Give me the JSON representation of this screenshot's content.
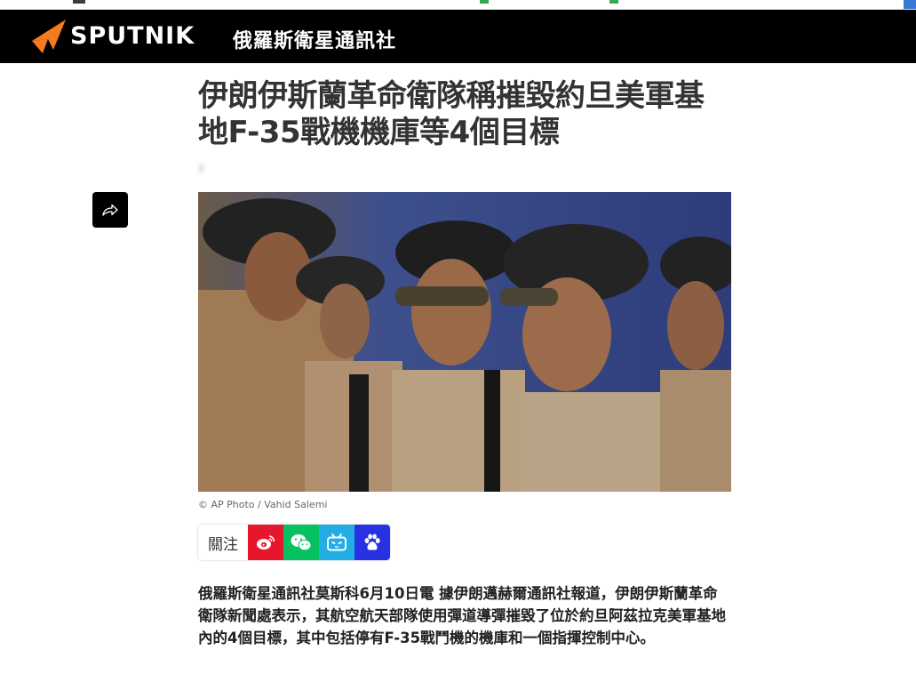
{
  "header": {
    "brand_name": "SPUTNIK",
    "brand_subtitle": "俄羅斯衛星通訊社",
    "brand_color": "#f47b20",
    "bar_color": "#000000"
  },
  "article": {
    "title": "伊朗伊斯蘭革命衛隊稱摧毀約旦美軍基地F-35戰機機庫等4個目標",
    "date": "2",
    "photo_credit": "© AP Photo / Vahid Salemi",
    "lead": "俄羅斯衛星通訊社莫斯科6月10日電 據伊朗邁赫爾通訊社報道，伊朗伊斯蘭革命衛隊新聞處表示，其航空航天部隊使用彈道導彈摧毀了位於約旦阿茲拉克美軍基地內的4個目標，其中包括停有F-35戰鬥機的機庫和一個指揮控制中心。"
  },
  "share": {
    "icon": "share-arrow-icon"
  },
  "follow": {
    "label": "關注",
    "services": [
      {
        "name": "weibo",
        "icon": "weibo-icon",
        "color": "#e6162d"
      },
      {
        "name": "wechat",
        "icon": "wechat-icon",
        "color": "#07c160"
      },
      {
        "name": "bilibili",
        "icon": "bilibili-icon",
        "color": "#23ade5"
      },
      {
        "name": "baidu",
        "icon": "baidu-paw-icon",
        "color": "#2932e1"
      }
    ]
  }
}
